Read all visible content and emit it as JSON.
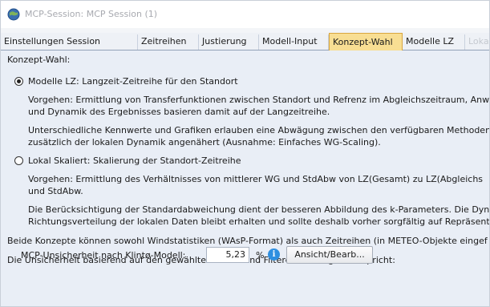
{
  "window": {
    "title": "MCP-Session: MCP Session (1)"
  },
  "tabs": [
    {
      "label": "Einstellungen Session",
      "state": "normal"
    },
    {
      "label": "Zeitreihen",
      "state": "normal"
    },
    {
      "label": "Justierung",
      "state": "normal"
    },
    {
      "label": "Modell-Input",
      "state": "normal"
    },
    {
      "label": "Konzept-Wahl",
      "state": "active"
    },
    {
      "label": "Modelle LZ",
      "state": "normal"
    },
    {
      "label": "Lokal skaliert",
      "state": "disabled"
    }
  ],
  "content": {
    "heading": "Konzept-Wahl:",
    "option1": {
      "label": "Modelle LZ: Langzeit-Zeitreihe für den Standort",
      "selected": true,
      "para1_line1": "Vorgehen: Ermittlung von Transferfunktionen zwischen Standort und Refrenz im Abgleichszeitraum, Anw",
      "para1_line2": "und Dynamik des Ergebnisses basieren damit auf der Langzeitreihe.",
      "para2_line1": "Unterschiedliche Kennwerte und Grafiken erlauben eine Abwägung zwischen den verfügbaren Methoden",
      "para2_line2": "zusätzlich der lokalen Dynamik angenähert (Ausnahme: Einfaches WG-Scaling)."
    },
    "option2": {
      "label": "Lokal Skaliert: Skalierung der Standort-Zeitreihe",
      "selected": false,
      "para1_line1": "Vorgehen: Ermittlung des Verhältnisses von mittlerer WG und StdAbw von LZ(Gesamt) zu LZ(Abgleichs",
      "para1_line2": "und StdAbw.",
      "para2_line1": "Die Berücksichtigung der Standardabweichung dient der besseren Abbildung des k-Parameters. Die Dyn",
      "para2_line2": "Richtungsverteilung der lokalen Daten bleibt erhalten und sollte deshalb vorher sorgfältig auf Repräsent"
    },
    "note": "Beide Konzepte können sowohl Windstatistiken (WAsP-Format) als auch Zeitreihen (in METEO-Objekte eingef",
    "uncertainty_heading": "Die Unsicherheit basierend auf den gewählten Daten und Filtereinstellungen entspricht:",
    "uncertainty_label": "MCP-Unsicherheit nach Klintø-Modell:",
    "uncertainty_value": "5,23",
    "uncertainty_unit": "%",
    "view_button": "Ansicht/Bearb..."
  },
  "colors": {
    "active_tab": "#f8de93",
    "panel_bg": "#e9eef6",
    "info_icon": "#2f8fe0",
    "disabled_text": "#c5c9d0"
  },
  "icons": {
    "app": "globe-app-icon",
    "info": "info-icon"
  }
}
